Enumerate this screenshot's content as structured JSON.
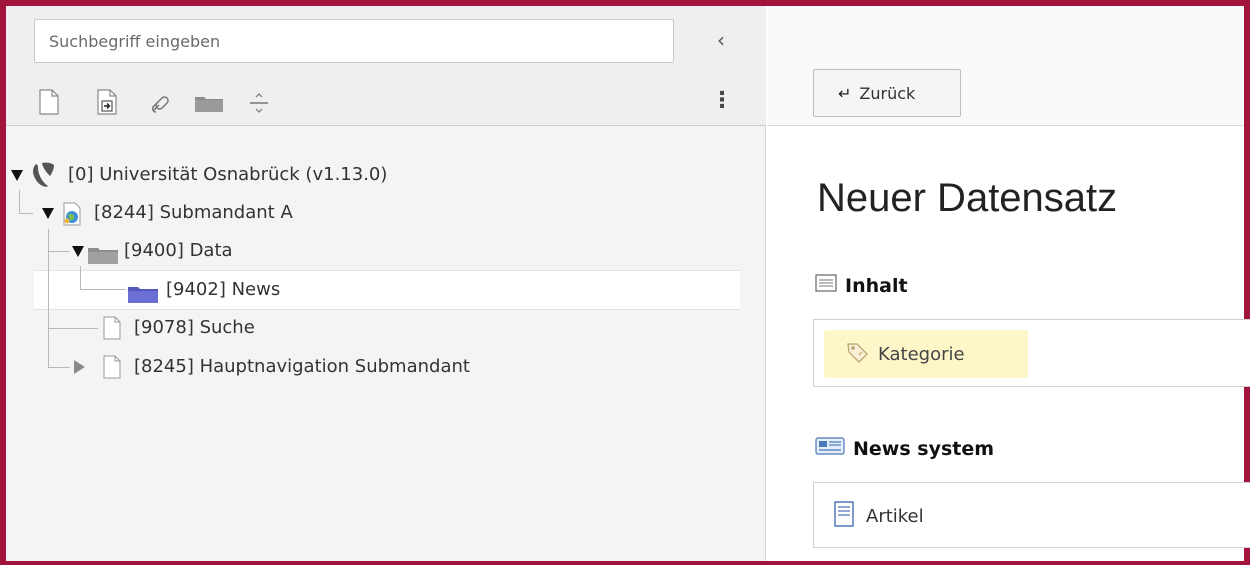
{
  "sidebar": {
    "search_placeholder": "Suchbegriff eingeben",
    "collapse_glyph": "‹",
    "more_glyph": "⋮",
    "toolbar_icons": [
      "new-page-icon",
      "page-import-icon",
      "link-icon",
      "folder-icon",
      "separator-icon"
    ],
    "tree": [
      {
        "label": "[0] Universität Osnabrück (v1.13.0)",
        "icon": "typo3-logo-icon",
        "expanded": true
      },
      {
        "label": "[8244] Submandant A",
        "icon": "site-page-icon",
        "expanded": true
      },
      {
        "label": "[9400] Data",
        "icon": "folder-icon",
        "expanded": true
      },
      {
        "label": "[9402] News",
        "icon": "news-folder-icon",
        "selected": true
      },
      {
        "label": "[9078] Suche",
        "icon": "page-icon"
      },
      {
        "label": "[8245] Hauptnavigation Submandant",
        "icon": "page-icon",
        "expanded": false
      }
    ]
  },
  "main": {
    "back_label": "Zurück",
    "back_glyph": "↵",
    "title": "Neuer Datensatz",
    "sections": [
      {
        "heading": "Inhalt",
        "icon": "content-icon",
        "items": [
          {
            "label": "Kategorie",
            "icon": "tag-icon"
          }
        ]
      },
      {
        "heading": "News system",
        "icon": "news-system-icon",
        "items": [
          {
            "label": "Artikel",
            "icon": "article-icon"
          }
        ]
      }
    ]
  },
  "colors": {
    "frame": "#a3143c",
    "highlight": "#fdf6c9",
    "folder_selected": "#6b6fd4"
  }
}
